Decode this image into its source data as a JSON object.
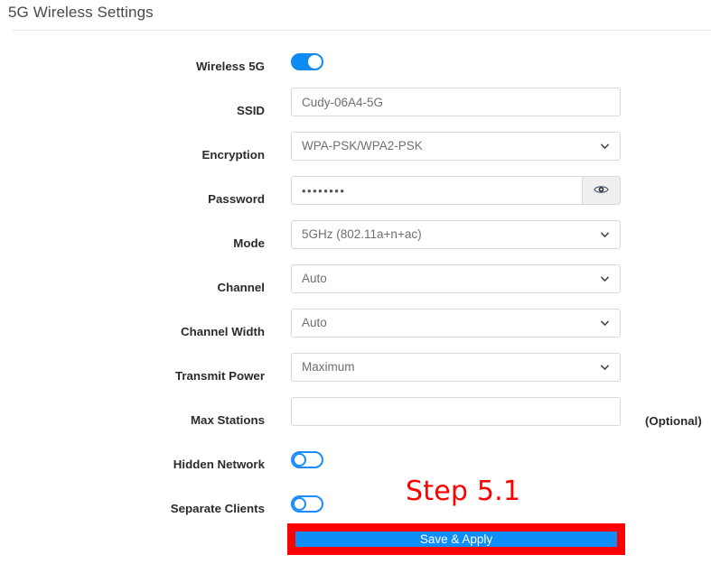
{
  "header": {
    "title": "5G Wireless Settings"
  },
  "form": {
    "rows": [
      {
        "label": "Wireless 5G",
        "type": "toggle",
        "state": "on",
        "name": "wireless-5g"
      },
      {
        "label": "SSID",
        "type": "text",
        "value": "Cudy-06A4-5G",
        "name": "ssid"
      },
      {
        "label": "Encryption",
        "type": "select",
        "value": "WPA-PSK/WPA2-PSK",
        "name": "encryption"
      },
      {
        "label": "Password",
        "type": "password",
        "value": "••••••••",
        "name": "password"
      },
      {
        "label": "Mode",
        "type": "select",
        "value": "5GHz (802.11a+n+ac)",
        "name": "mode"
      },
      {
        "label": "Channel",
        "type": "select",
        "value": "Auto",
        "name": "channel"
      },
      {
        "label": "Channel Width",
        "type": "select",
        "value": "Auto",
        "name": "channel-width"
      },
      {
        "label": "Transmit Power",
        "type": "select",
        "value": "Maximum",
        "name": "transmit-power"
      },
      {
        "label": "Max Stations",
        "type": "text",
        "value": "",
        "hint": "(Optional)",
        "name": "max-stations"
      },
      {
        "label": "Hidden Network",
        "type": "toggle",
        "state": "off",
        "name": "hidden-network"
      },
      {
        "label": "Separate Clients",
        "type": "toggle",
        "state": "off",
        "name": "separate-clients"
      }
    ]
  },
  "annotation": {
    "step_text": "Step 5.1",
    "color": "#ff0000"
  },
  "actions": {
    "save_label": "Save & Apply",
    "save_color": "#108ef7",
    "highlight_color": "#ff0000"
  },
  "icons": {
    "eye": "eye-icon",
    "chevron": "chevron-down-icon"
  }
}
